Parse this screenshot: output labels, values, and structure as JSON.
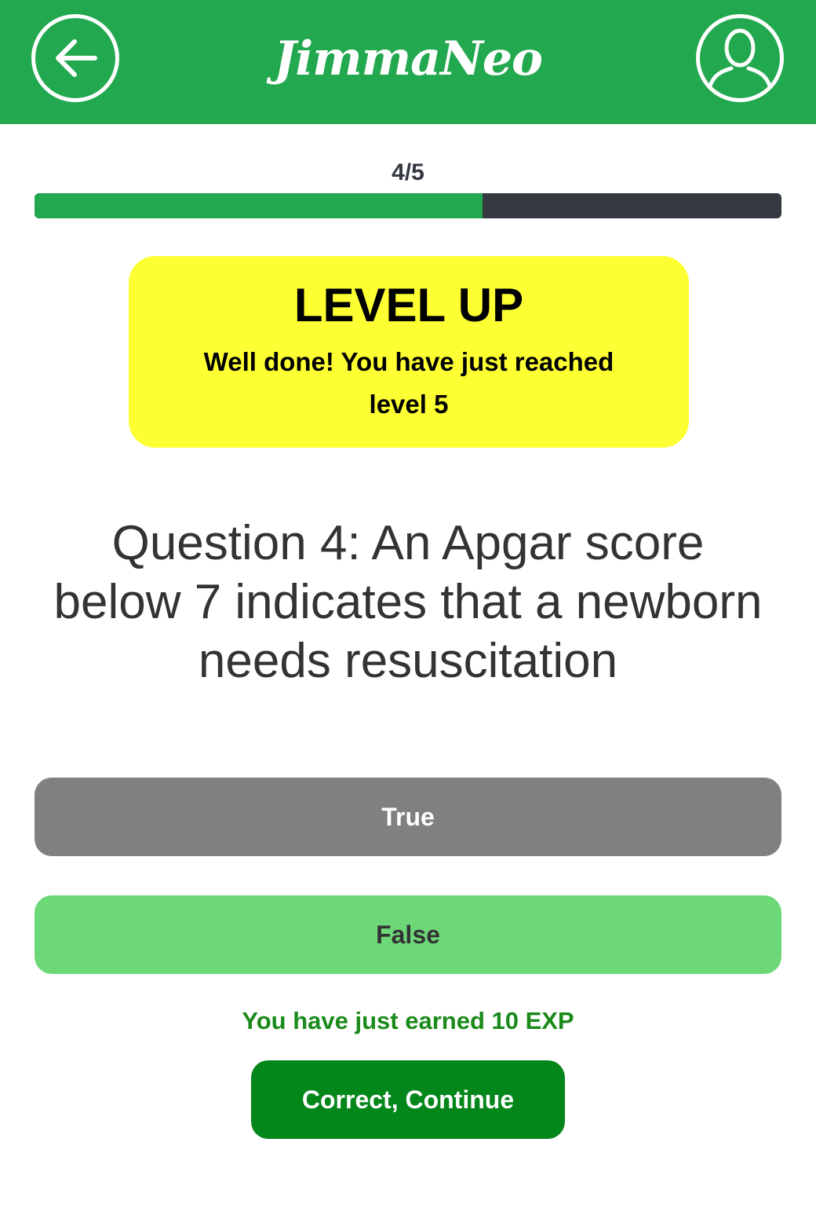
{
  "header": {
    "app_name": "JimmaNeo",
    "back_icon": "arrow-left-icon",
    "profile_icon": "user-silhouette-icon",
    "color": "#22a84e"
  },
  "progress": {
    "label": "4/5",
    "current": 4,
    "total": 5,
    "fill_percent": 60,
    "fill_color": "#22a84e",
    "track_color": "#343a40"
  },
  "level_up": {
    "title": "LEVEL UP",
    "message": "Well done! You have just reached level 5",
    "background": "#fdff33"
  },
  "question": {
    "text": "Question 4: An Apgar score below 7 indicates that a newborn needs resuscitation"
  },
  "answers": [
    {
      "label": "True",
      "state": "not-selected",
      "color": "#808080"
    },
    {
      "label": "False",
      "state": "correct",
      "color": "#6dd878"
    }
  ],
  "feedback": {
    "earned_text": "You have just earned 10 EXP",
    "color": "#1a8a1a"
  },
  "continue_button": {
    "label": "Correct, Continue",
    "color": "#03861a"
  }
}
